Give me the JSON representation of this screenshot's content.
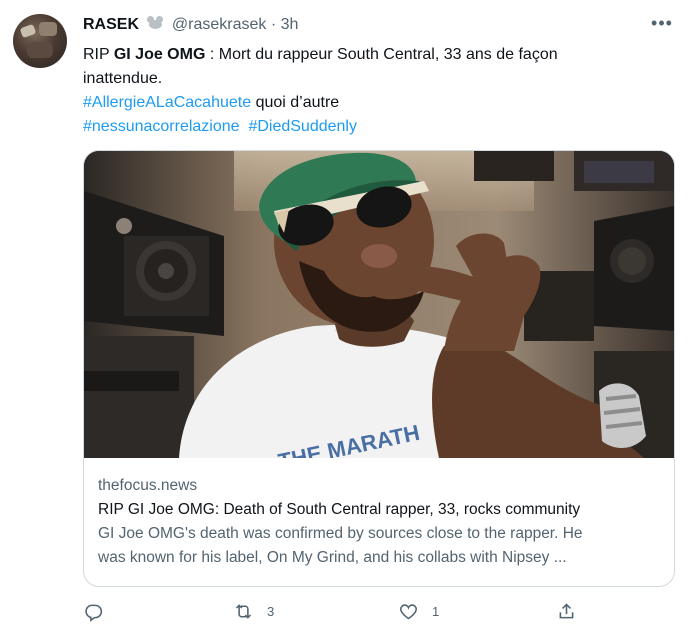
{
  "author": {
    "display_name": "RASEK",
    "emoji": "mouse-emoji",
    "handle": "@rasekrasek",
    "separator": "·",
    "time": "3h"
  },
  "tweet": {
    "line1_prefix": "RIP ",
    "line1_bold": "GI Joe OMG",
    "line1_rest": " : Mort du rappeur South Central, 33 ans de façon",
    "line2": "inattendue.",
    "hashtag1": "#AllergieALaCacahuete",
    "line3_rest": " quoi d’autre",
    "hashtag2": "#nessunacorrelazione",
    "hashtag3": "#DiedSuddenly"
  },
  "card": {
    "shirt_text": "THE MARATH",
    "domain": "thefocus.news",
    "title": "RIP GI Joe OMG: Death of South Central rapper, 33, rocks community",
    "description_line1": "GI Joe OMG's death was confirmed by sources close to the rapper. He",
    "description_line2": "was known for his label, On My Grind, and his collabs with Nipsey ..."
  },
  "actions": {
    "reply_icon": "reply-icon",
    "retweet_icon": "retweet-icon",
    "retweet_count": "3",
    "like_icon": "like-icon",
    "like_count": "1",
    "share_icon": "share-icon"
  },
  "colors": {
    "link": "#1d9bf0",
    "muted": "#536471",
    "text": "#0f1419",
    "border": "#cfd9de"
  }
}
